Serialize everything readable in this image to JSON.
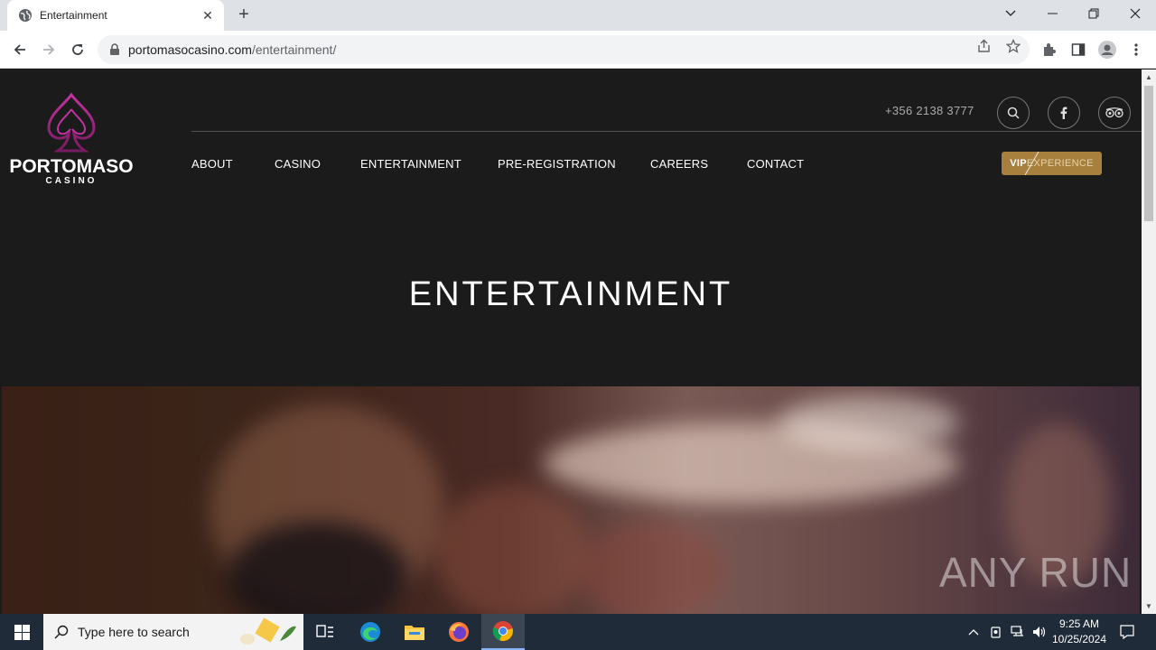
{
  "browser": {
    "tab_title": "Entertainment",
    "url_domain": "portomasocasino.com",
    "url_path": "/entertainment/"
  },
  "site": {
    "logo_brand": "PORTOMASO",
    "logo_sub": "CASINO",
    "phone": "+356 2138 3777",
    "nav": [
      "ABOUT",
      "CASINO",
      "ENTERTAINMENT",
      "PRE-REGISTRATION",
      "CAREERS",
      "CONTACT"
    ],
    "vip_bold": "VIP",
    "vip_rest": "EXPERIENCE",
    "heading": "ENTERTAINMENT",
    "accent_color": "#a8803e",
    "logo_color": "#b0258f"
  },
  "watermark": "ANY RUN",
  "taskbar": {
    "search_placeholder": "Type here to search",
    "time": "9:25 AM",
    "date": "10/25/2024"
  }
}
